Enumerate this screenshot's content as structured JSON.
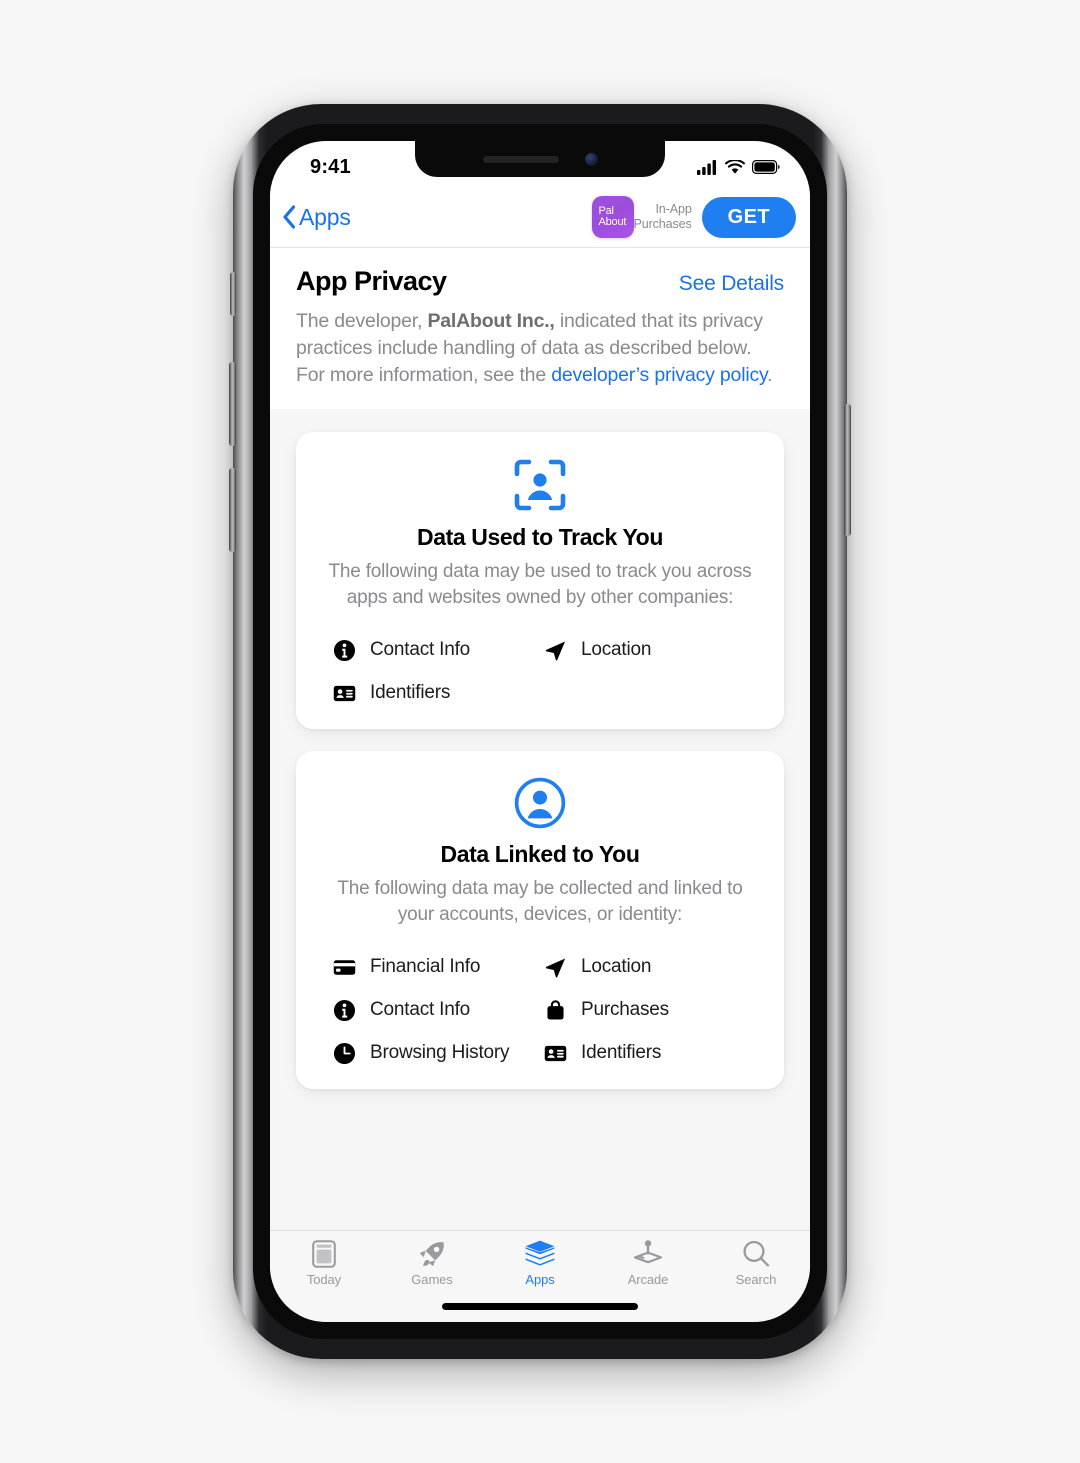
{
  "status_bar": {
    "time": "9:41",
    "icons": [
      "cellular-signal-icon",
      "wifi-icon",
      "battery-icon"
    ]
  },
  "nav_bar": {
    "back_label": "Apps",
    "back_icon": "chevron-left-icon",
    "app_icon": {
      "name": "palabout-app-icon",
      "line1": "Pal",
      "line2": "About",
      "gradient_start": "#a050e0",
      "gradient_end": "#a855e8"
    },
    "in_app_purchases_line1": "In-App",
    "in_app_purchases_line2": "Purchases",
    "get_label": "GET",
    "get_color": "#1f7ef0"
  },
  "privacy": {
    "title": "App Privacy",
    "see_details": "See Details",
    "desc_part1": "The developer, ",
    "desc_developer": "PalAbout Inc.,",
    "desc_part2": " indicated that its privacy practices include handling of data as described below. For more information, see the ",
    "desc_link": "developer’s privacy policy",
    "desc_end": "."
  },
  "cards": [
    {
      "icon": "person-in-viewfinder-icon",
      "title": "Data Used to Track You",
      "subtitle": "The following data may be used to track you across apps and websites owned by other companies:",
      "items": [
        {
          "icon": "info-circle-icon",
          "label": "Contact Info"
        },
        {
          "icon": "location-arrow-icon",
          "label": "Location"
        },
        {
          "icon": "id-card-icon",
          "label": "Identifiers"
        }
      ]
    },
    {
      "icon": "person-circle-icon",
      "title": "Data Linked to You",
      "subtitle": "The following data may be collected and linked to your accounts, devices, or identity:",
      "items": [
        {
          "icon": "credit-card-icon",
          "label": "Financial Info"
        },
        {
          "icon": "location-arrow-icon",
          "label": "Location"
        },
        {
          "icon": "info-circle-icon",
          "label": "Contact Info"
        },
        {
          "icon": "shopping-bag-icon",
          "label": "Purchases"
        },
        {
          "icon": "clock-icon",
          "label": "Browsing History"
        },
        {
          "icon": "id-card-icon",
          "label": "Identifiers"
        }
      ]
    }
  ],
  "tab_bar": {
    "active": "Apps",
    "tabs": [
      {
        "icon": "today-card-icon",
        "label": "Today"
      },
      {
        "icon": "rocket-icon",
        "label": "Games"
      },
      {
        "icon": "layers-stack-icon",
        "label": "Apps"
      },
      {
        "icon": "arcade-joystick-icon",
        "label": "Arcade"
      },
      {
        "icon": "magnifier-icon",
        "label": "Search"
      }
    ],
    "accent_color": "#1f7ef0",
    "inactive_color": "#9a9a9e"
  }
}
